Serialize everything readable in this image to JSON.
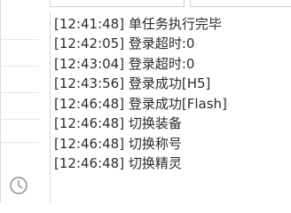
{
  "log": {
    "entries": [
      {
        "time": "[12:41:48]",
        "message": "单任务执行完毕"
      },
      {
        "time": "[12:42:05]",
        "message": "登录超时:0"
      },
      {
        "time": "[12:43:04]",
        "message": "登录超时:0"
      },
      {
        "time": "[12:43:56]",
        "message": "登录成功[H5]"
      },
      {
        "time": "[12:46:48]",
        "message": "登录成功[Flash]"
      },
      {
        "time": "[12:46:48]",
        "message": "切换装备"
      },
      {
        "time": "[12:46:48]",
        "message": "切换称号"
      },
      {
        "time": "[12:46:48]",
        "message": "切换精灵"
      }
    ]
  },
  "icons": {
    "corner": "clock-icon"
  },
  "colors": {
    "text": "#2c2c2c",
    "border": "#d8d8d8",
    "background": "#ffffff"
  }
}
